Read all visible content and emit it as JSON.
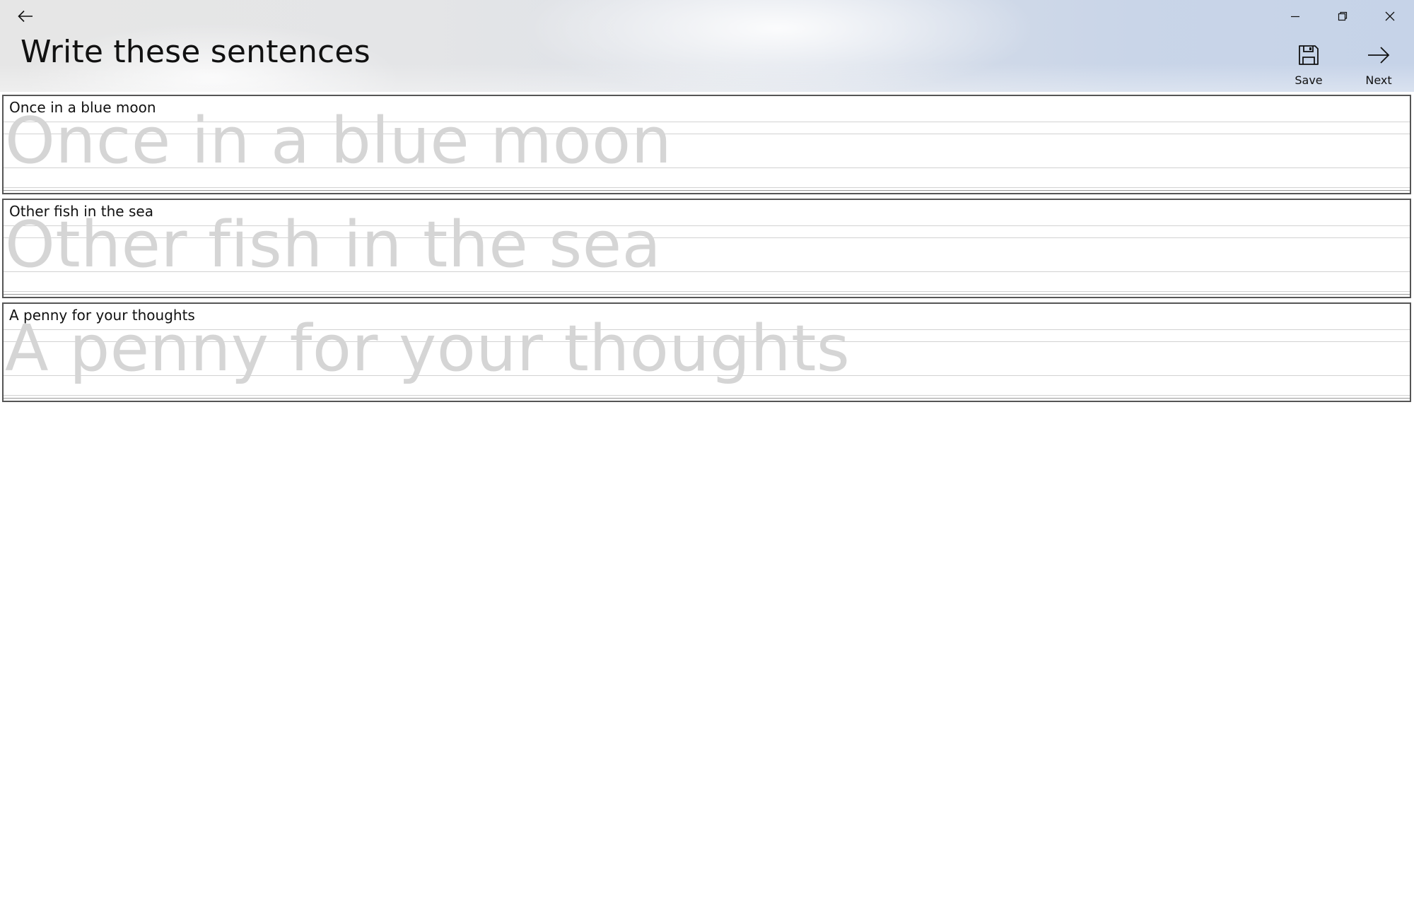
{
  "window": {
    "title": "Write these sentences",
    "caption_buttons": [
      {
        "name": "minimize",
        "icon": "minimize-icon"
      },
      {
        "name": "restore",
        "icon": "restore-icon"
      },
      {
        "name": "close",
        "icon": "close-icon"
      }
    ]
  },
  "toolbar": {
    "save_label": "Save",
    "save_icon": "save-icon",
    "next_label": "Next",
    "next_icon": "arrow-right-icon"
  },
  "navigation": {
    "back_icon": "arrow-left-icon"
  },
  "exercises": [
    {
      "prompt": "Once in a blue moon",
      "trace": "Once in a blue moon"
    },
    {
      "prompt": "Other fish in the sea",
      "trace": "Other fish in the sea"
    },
    {
      "prompt": "A penny for your thoughts",
      "trace": "A penny for your thoughts"
    }
  ],
  "colors": {
    "trace_text": "#d5d5d5",
    "card_border": "#555555",
    "guide_line": "#d2d2d2"
  }
}
